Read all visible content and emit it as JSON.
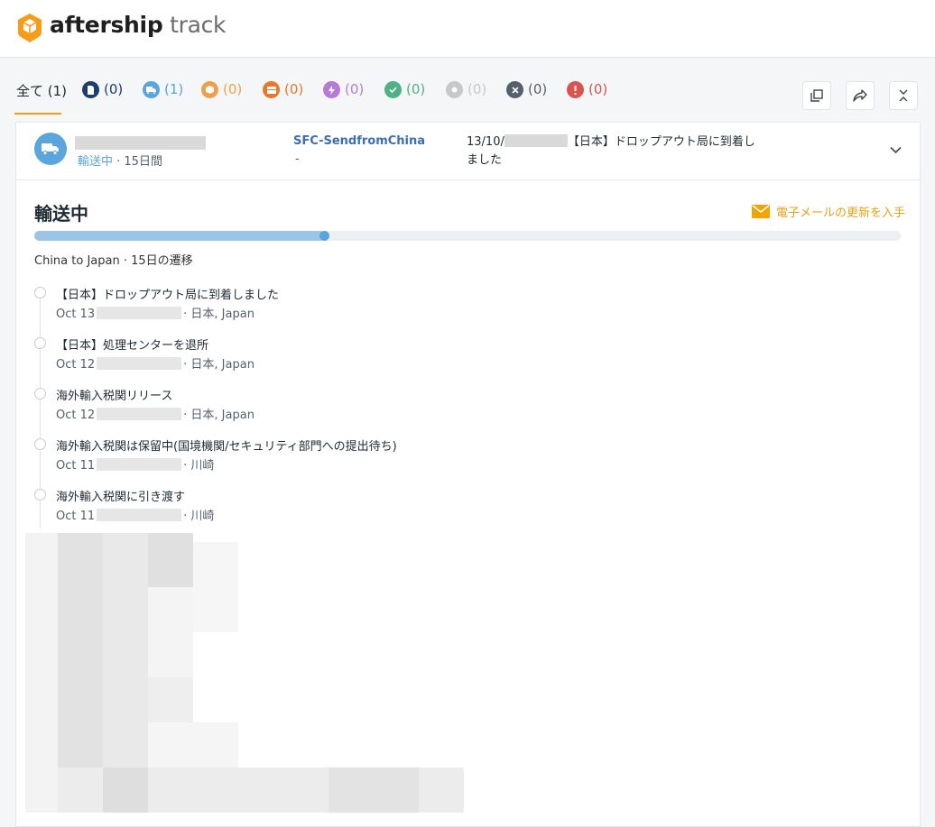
{
  "header": {
    "brand": "aftership",
    "suffix": "track",
    "logo_color": "#f59c1a"
  },
  "tabs": [
    {
      "label": "全て (1)",
      "icon": "all-label",
      "color": "#1f2933"
    },
    {
      "label": "(0)",
      "icon": "document-icon",
      "color": "#1c3d6e"
    },
    {
      "label": "(1)",
      "icon": "truck-icon",
      "color": "#5aa5dc"
    },
    {
      "label": "(0)",
      "icon": "package-icon",
      "color": "#f0a04b"
    },
    {
      "label": "(0)",
      "icon": "delivery-icon",
      "color": "#e5792b"
    },
    {
      "label": "(0)",
      "icon": "lightning-icon",
      "color": "#b57bd6"
    },
    {
      "label": "(0)",
      "icon": "check-icon",
      "color": "#4fb286"
    },
    {
      "label": "(0)",
      "icon": "expired-icon",
      "color": "#c8c8c8"
    },
    {
      "label": "(0)",
      "icon": "close-icon",
      "color": "#55606c"
    },
    {
      "label": "(0)",
      "icon": "exclamation-icon",
      "color": "#d9534f"
    }
  ],
  "toolbar": {
    "copy_icon": "copy-icon",
    "share_icon": "share-icon",
    "collapse_icon": "collapse-icon"
  },
  "shipment": {
    "status": "輸送中",
    "days": " · 15日間",
    "courier": "SFC-SendfromChina",
    "courier_sub": "-",
    "latest_prefix": "13/10/",
    "latest_text": "【日本】ドロップアウト局に到着しました",
    "status_color": "#5aa5dc"
  },
  "detail": {
    "title": "輸送中",
    "email_link": "電子メールの更新を入手",
    "progress_fraction": 0.335,
    "route": "China to Japan · 15日の遷移"
  },
  "events": [
    {
      "desc": "【日本】ドロップアウト局に到着しました",
      "date": "Oct 13",
      "location": "· 日本, Japan"
    },
    {
      "desc": "【日本】処理センターを退所",
      "date": "Oct 12",
      "location": "· 日本, Japan"
    },
    {
      "desc": "海外輸入税関リリース",
      "date": "Oct 12",
      "location": "· 日本, Japan"
    },
    {
      "desc": "海外輸入税関は保留中(国境機関/セキュリティ部門への提出待ち)",
      "date": "Oct 11",
      "location": "· 川崎"
    },
    {
      "desc": "海外輸入税関に引き渡す",
      "date": "Oct 11",
      "location": "· 川崎"
    }
  ]
}
